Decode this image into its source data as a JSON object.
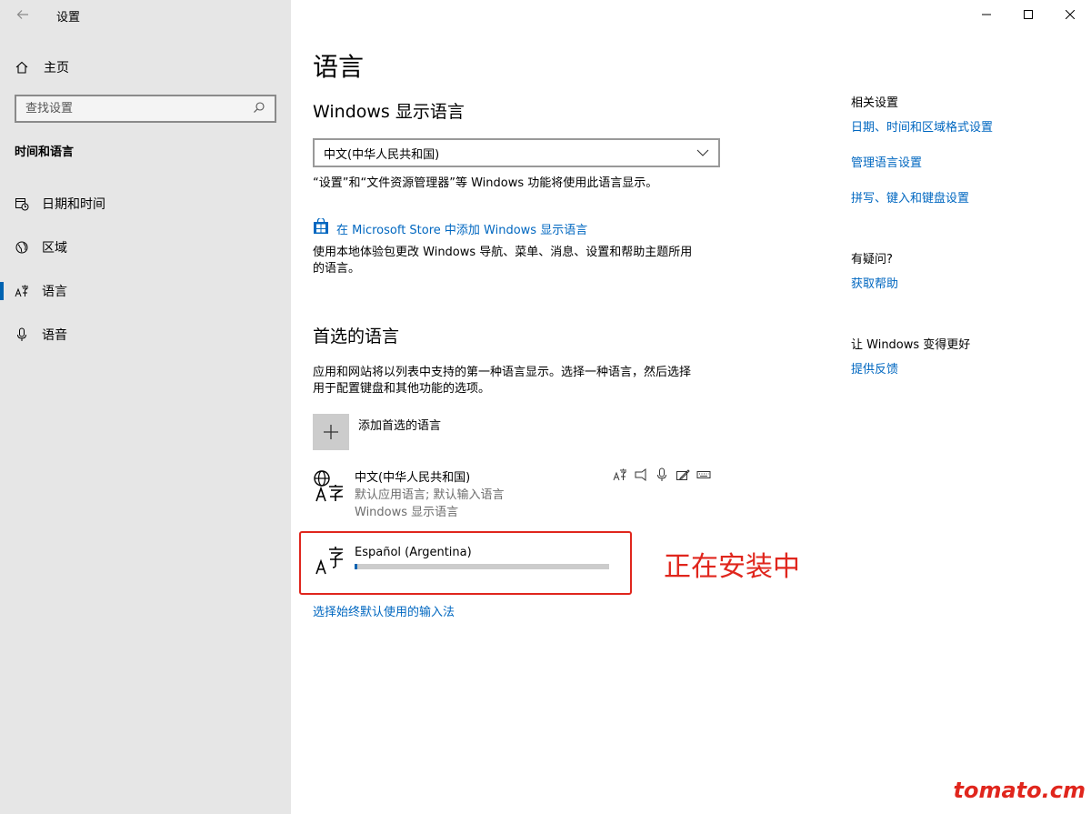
{
  "window": {
    "app_title": "设置",
    "caption": {
      "minimize": "─",
      "maximize": "☐",
      "close": "✕"
    }
  },
  "sidebar": {
    "home_label": "主页",
    "search_placeholder": "查找设置",
    "section_title": "时间和语言",
    "items": [
      {
        "label": "日期和时间",
        "icon": "calendar-clock-icon"
      },
      {
        "label": "区域",
        "icon": "globe-region-icon"
      },
      {
        "label": "语言",
        "icon": "language-icon",
        "active": true
      },
      {
        "label": "语音",
        "icon": "microphone-icon"
      }
    ]
  },
  "main": {
    "page_title": "语言",
    "display_language": {
      "heading": "Windows 显示语言",
      "selected": "中文(中华人民共和国)",
      "description": "“设置”和“文件资源管理器”等 Windows 功能将使用此语言显示。",
      "store_link": "在 Microsoft Store 中添加 Windows 显示语言",
      "store_description_line1": "使用本地体验包更改 Windows 导航、菜单、消息、设置和帮助主题所用",
      "store_description_line2": "的语言。"
    },
    "preferred": {
      "heading": "首选的语言",
      "description_line1": "应用和网站将以列表中支持的第一种语言显示。选择一种语言，然后选择",
      "description_line2": "用于配置键盘和其他功能的选项。",
      "add_label": "添加首选的语言",
      "languages": [
        {
          "name": "中文(中华人民共和国)",
          "line2": "默认应用语言; 默认输入语言",
          "line3": "Windows 显示语言"
        },
        {
          "name": "Español (Argentina)",
          "install_progress": 0.01
        }
      ],
      "input_method_link": "选择始终默认使用的输入法"
    },
    "annotation": "正在安装中"
  },
  "related": {
    "heading": "相关设置",
    "links": [
      "日期、时间和区域格式设置",
      "管理语言设置",
      "拼写、键入和键盘设置"
    ],
    "help_heading": "有疑问?",
    "help_link": "获取帮助",
    "feedback_heading": "让 Windows 变得更好",
    "feedback_link": "提供反馈"
  },
  "watermark": "tomato.cm",
  "colors": {
    "accent": "#0063b1",
    "link": "#0067c0",
    "annotation": "#e0261d",
    "sidebar_bg": "#e6e6e6"
  }
}
